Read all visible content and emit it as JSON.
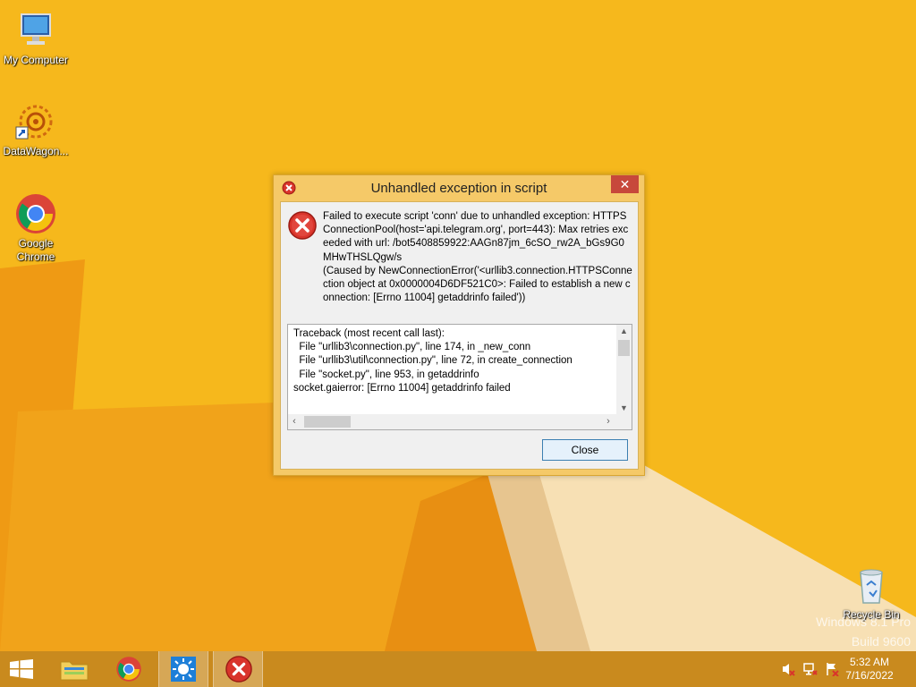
{
  "desktop": {
    "icons": [
      {
        "label": "My Computer"
      },
      {
        "label": "DataWagon..."
      },
      {
        "label": "Google Chrome"
      },
      {
        "label": "Recycle Bin"
      }
    ],
    "watermark": [
      "Windows 8.1 Pro",
      "Build 9600"
    ]
  },
  "dialog": {
    "title": "Unhandled exception in script",
    "close_glyph": "✕",
    "message": "Failed to execute script 'conn' due to unhandled exception: HTTPSConnectionPool(host='api.telegram.org', port=443): Max retries exceeded with url: /bot5408859922:AAGn87jm_6cSO_rw2A_bGs9G0MHwTHSLQgw/s\n(Caused by NewConnectionError('<urllib3.connection.HTTPSConnection object at 0x0000004D6DF521C0>: Failed to establish a new connection: [Errno 11004] getaddrinfo failed'))",
    "traceback": "Traceback (most recent call last):\n  File \"urllib3\\connection.py\", line 174, in _new_conn\n  File \"urllib3\\util\\connection.py\", line 72, in create_connection\n  File \"socket.py\", line 953, in getaddrinfo\nsocket.gaierror: [Errno 11004] getaddrinfo failed",
    "close_button": "Close"
  },
  "taskbar": {
    "clock_time": "5:32 AM",
    "clock_date": "7/16/2022"
  },
  "colors": {
    "desktop": "#f6b81c",
    "taskbar": "#c98a1e",
    "dialog_frame": "#f5c968",
    "error_red": "#d9342b"
  }
}
